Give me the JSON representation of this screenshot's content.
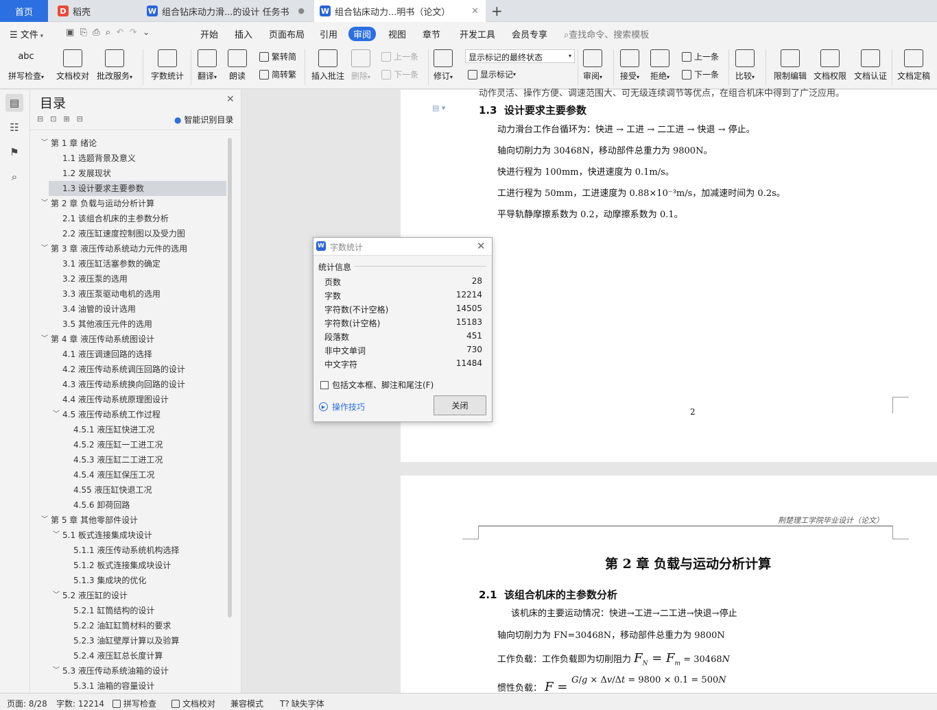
{
  "tabs": {
    "home": "首页",
    "daoke": "稻壳",
    "doc1": "组合钻床动力滑...的设计 任务书",
    "doc2": "组合钻床动力...明书（论文）",
    "new_tab": "+"
  },
  "menu": {
    "file": "文件",
    "items": [
      "开始",
      "插入",
      "页面布局",
      "引用",
      "审阅",
      "视图",
      "章节",
      "开发工具",
      "会员专享"
    ],
    "search_placeholder": "查找命令、搜索模板"
  },
  "ribbon": {
    "spellcheck": "拼写检查",
    "proofread": "文档校对",
    "annotate_service": "批改服务",
    "word_count": "字数统计",
    "translate": "翻译",
    "read_aloud": "朗读",
    "trad_to_simp": "繁转简",
    "simp_to_trad": "简转繁",
    "insert_comment": "插入批注",
    "delete": "删除",
    "prev_comment": "上一条",
    "next_comment": "下一条",
    "track_changes": "修订",
    "markup_mode": "显示标记的最终状态",
    "show_markup": "显示标记",
    "review": "审阅",
    "accept": "接受",
    "reject": "拒绝",
    "prev_change": "上一条",
    "next_change": "下一条",
    "compare": "比较",
    "restrict_edit": "限制编辑",
    "doc_permission": "文档权限",
    "doc_cert": "文档认证",
    "doc_finalize": "文档定稿",
    "abc": "abc"
  },
  "toc": {
    "title": "目录",
    "smart": "智能识别目录",
    "items": [
      {
        "text": "第 1 章  绪论",
        "level": 0,
        "toggle": "open"
      },
      {
        "text": "1.1  选题背景及意义",
        "level": 1
      },
      {
        "text": "1.2  发展现状",
        "level": 1
      },
      {
        "text": "1.3  设计要求主要参数",
        "level": 1,
        "selected": true
      },
      {
        "text": "第 2 章  负载与运动分析计算",
        "level": 0,
        "toggle": "open"
      },
      {
        "text": "2.1  该组合机床的主参数分析",
        "level": 1
      },
      {
        "text": "2.2  液压缸速度控制图以及受力图",
        "level": 1
      },
      {
        "text": "第 3 章  液压传动系统动力元件的选用",
        "level": 0,
        "toggle": "open"
      },
      {
        "text": "3.1  液压缸活塞参数的确定",
        "level": 1
      },
      {
        "text": "3.2  液压泵的选用",
        "level": 1
      },
      {
        "text": "3.3  液压泵驱动电机的选用",
        "level": 1
      },
      {
        "text": "3.4  油管的设计选用",
        "level": 1
      },
      {
        "text": "3.5  其他液压元件的选用",
        "level": 1
      },
      {
        "text": "第 4 章  液压传动系统图设计",
        "level": 0,
        "toggle": "open"
      },
      {
        "text": "4.1  液压调速回路的选择",
        "level": 1
      },
      {
        "text": "4.2  液压传动系统调压回路的设计",
        "level": 1
      },
      {
        "text": "4.3  液压传动系统换向回路的设计",
        "level": 1
      },
      {
        "text": "4.4  液压传动系统原理图设计",
        "level": 1
      },
      {
        "text": "4.5  液压传动系统工作过程",
        "level": 1,
        "toggle": "open"
      },
      {
        "text": "4.5.1  液压缸快进工况",
        "level": 2
      },
      {
        "text": "4.5.2  液压缸一工进工况",
        "level": 2
      },
      {
        "text": "4.5.3 液压缸二工进工况",
        "level": 2
      },
      {
        "text": "4.5.4  液压缸保压工况",
        "level": 2
      },
      {
        "text": "4.55  液压缸快退工况",
        "level": 2
      },
      {
        "text": "4.5.6  卸荷回路",
        "level": 2
      },
      {
        "text": "第 5 章  其他零部件设计",
        "level": 0,
        "toggle": "open"
      },
      {
        "text": "5.1  板式连接集成块设计",
        "level": 1,
        "toggle": "open"
      },
      {
        "text": "5.1.1  液压传动系统机构选择",
        "level": 2
      },
      {
        "text": "5.1.2  板式连接集成块设计",
        "level": 2
      },
      {
        "text": "5.1.3  集成块的优化",
        "level": 2
      },
      {
        "text": "5.2  液压缸的设计",
        "level": 1,
        "toggle": "open"
      },
      {
        "text": "5.2.1  缸筒结构的设计",
        "level": 2
      },
      {
        "text": "5.2.2  油缸缸筒材料的要求",
        "level": 2
      },
      {
        "text": "5.2.3  油缸壁厚计算以及验算",
        "level": 2
      },
      {
        "text": "5.2.4  液压缸总长度计算",
        "level": 2
      },
      {
        "text": "5.3  液压传动系统油箱的设计",
        "level": 1,
        "toggle": "open"
      },
      {
        "text": "5.3.1  油箱的容量设计",
        "level": 2
      }
    ]
  },
  "page1": {
    "cut_text": "动作灵活、操作方便、调速范围大、可无级连续调节等优点，在组合机床中得到了广泛应用。",
    "heading_num": "1.3",
    "heading": "设计要求主要参数",
    "lines": [
      "动力滑台工作台循环为：快进 → 工进 → 二工进 → 快退 → 停止。",
      "轴向切削力为 30468N，移动部件总重力为 9800N。",
      "快进行程为 100mm，快进速度为 0.1m/s。",
      "工进行程为 50mm，工进速度为 0.88×10⁻³m/s，加减速时间为 0.2s。",
      "平导轨静摩擦系数为 0.2，动摩擦系数为 0.1。"
    ],
    "page_number": "2"
  },
  "page2": {
    "header": "荆楚理工学院毕业设计（论文）",
    "chapter": "第 2 章  负载与运动分析计算",
    "section_num": "2.1",
    "section": "该组合机床的主参数分析",
    "line1": "该机床的主要运动情况：快进→工进→二工进→快退→停止",
    "line2": "轴向切削力为 FN=30468N，移动部件总重力为 9800N",
    "line3_prefix": "工作负载：工作负载即为切削阻力",
    "line3_formula": "F_N = F_m = 30468N",
    "line4_prefix": "惯性负载：",
    "line4_formula": "F = G/g × Δv/Δt = 9800 × 0.1 = 500N"
  },
  "dialog": {
    "title": "字数统计",
    "section": "统计信息",
    "rows": [
      {
        "label": "页数",
        "value": "28"
      },
      {
        "label": "字数",
        "value": "12214"
      },
      {
        "label": "字符数(不计空格)",
        "value": "14505"
      },
      {
        "label": "字符数(计空格)",
        "value": "15183"
      },
      {
        "label": "段落数",
        "value": "451"
      },
      {
        "label": "非中文单词",
        "value": "730"
      },
      {
        "label": "中文字符",
        "value": "11484"
      }
    ],
    "checkbox": "包括文本框、脚注和尾注(F)",
    "tips": "操作技巧",
    "close": "关闭"
  },
  "status": {
    "page": "页面: 8/28",
    "words": "字数: 12214",
    "spell": "拼写检查",
    "proof": "文档校对",
    "compat": "兼容模式",
    "missing_font": "缺失字体"
  },
  "colors": {
    "accent": "#2b6fe0",
    "wps_red": "#e84a3a"
  }
}
